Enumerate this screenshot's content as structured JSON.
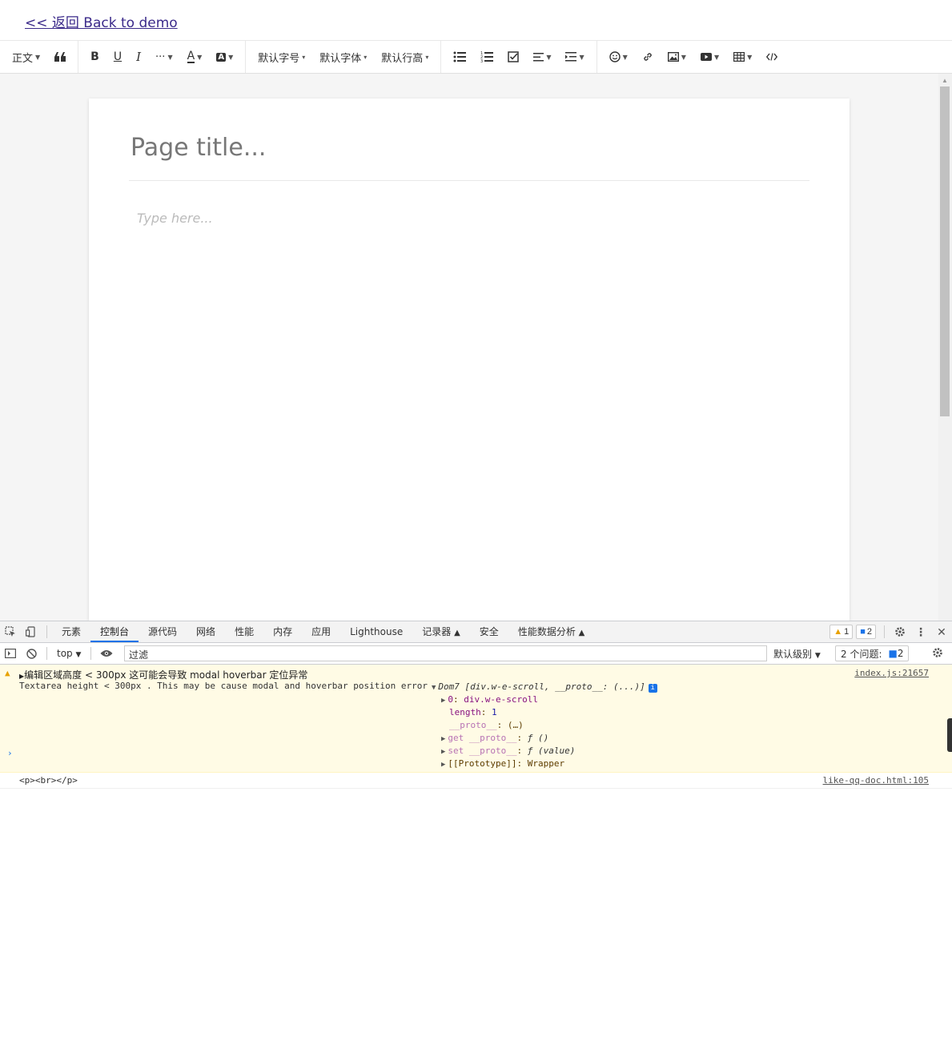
{
  "back_link": "<< 返回 Back to demo",
  "toolbar": {
    "paragraph": "正文",
    "font_size": "默认字号",
    "font_family": "默认字体",
    "line_height": "默认行高",
    "more": "···"
  },
  "editor": {
    "title_placeholder": "Page title...",
    "body_placeholder": "Type here..."
  },
  "devtools": {
    "tabs": [
      "元素",
      "控制台",
      "源代码",
      "网络",
      "性能",
      "内存",
      "应用",
      "Lighthouse",
      "记录器",
      "安全",
      "性能数据分析"
    ],
    "active_tab": "控制台",
    "warning_count": "1",
    "message_count": "2",
    "context": "top",
    "filter_placeholder": "过滤",
    "level": "默认级别",
    "issues_label": "2 个问题:",
    "issues_count": "2",
    "logs": {
      "warn_line1_cn": "编辑区域高度 < 300px 这可能会导致 modal hoverbar 定位异常",
      "warn_line2": "Textarea height < 300px . This may be cause modal and hoverbar position error",
      "warn_src": "index.js:21657",
      "obj_head": "Dom7 [div.w-e-scroll, __proto__: (...)]",
      "obj_item0_key": "0",
      "obj_item0_val": "div.w-e-scroll",
      "obj_length_key": "length",
      "obj_length_val": "1",
      "obj_proto_key": "__proto__",
      "obj_proto_val": "(…)",
      "obj_get": "get __proto__",
      "obj_get_val": "ƒ ()",
      "obj_set": "set __proto__",
      "obj_set_val": "ƒ (value)",
      "obj_prototype": "[[Prototype]]",
      "obj_prototype_val": "Wrapper",
      "plain_text": "<p><br></p>",
      "plain_src": "like-qq-doc.html:105"
    }
  },
  "colors": {
    "accent": "#1a73e8",
    "warning_bg": "#fffbe5",
    "warning_icon": "#e8a200",
    "link": "#3b2a8a"
  }
}
